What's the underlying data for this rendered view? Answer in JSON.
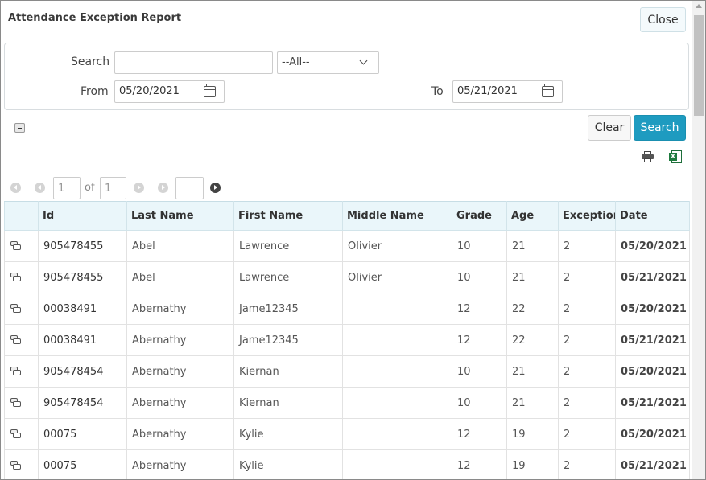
{
  "window": {
    "title": "Attendance Exception Report",
    "close_label": "Close"
  },
  "filters": {
    "search_label": "Search",
    "search_value": "",
    "select_value": "--All--",
    "from_label": "From",
    "from_value": "05/20/2021",
    "to_label": "To",
    "to_value": "05/21/2021"
  },
  "actions": {
    "clear_label": "Clear",
    "search_label": "Search"
  },
  "pager": {
    "current_page": "1",
    "of_label": "of",
    "total_pages": "1",
    "goto_value": ""
  },
  "table": {
    "headers": [
      "",
      "Id",
      "Last Name",
      "First Name",
      "Middle Name",
      "Grade",
      "Age",
      "Exception",
      "Date"
    ],
    "rows": [
      {
        "id": "905478455",
        "last": "Abel",
        "first": "Lawrence",
        "middle": "Olivier",
        "grade": "10",
        "age": "21",
        "exception": "2",
        "date": "05/20/2021"
      },
      {
        "id": "905478455",
        "last": "Abel",
        "first": "Lawrence",
        "middle": "Olivier",
        "grade": "10",
        "age": "21",
        "exception": "2",
        "date": "05/21/2021"
      },
      {
        "id": "00038491",
        "last": "Abernathy",
        "first": "Jame12345",
        "middle": "",
        "grade": "12",
        "age": "22",
        "exception": "2",
        "date": "05/20/2021"
      },
      {
        "id": "00038491",
        "last": "Abernathy",
        "first": "Jame12345",
        "middle": "",
        "grade": "12",
        "age": "22",
        "exception": "2",
        "date": "05/21/2021"
      },
      {
        "id": "905478454",
        "last": "Abernathy",
        "first": "Kiernan",
        "middle": "",
        "grade": "10",
        "age": "21",
        "exception": "2",
        "date": "05/20/2021"
      },
      {
        "id": "905478454",
        "last": "Abernathy",
        "first": "Kiernan",
        "middle": "",
        "grade": "10",
        "age": "21",
        "exception": "2",
        "date": "05/21/2021"
      },
      {
        "id": "00075",
        "last": "Abernathy",
        "first": "Kylie",
        "middle": "",
        "grade": "12",
        "age": "19",
        "exception": "2",
        "date": "05/20/2021"
      },
      {
        "id": "00075",
        "last": "Abernathy",
        "first": "Kylie",
        "middle": "",
        "grade": "12",
        "age": "19",
        "exception": "2",
        "date": "05/21/2021"
      }
    ]
  },
  "icons": {
    "row_action": "view-record-icon",
    "print": "print-icon",
    "export": "excel-export-icon",
    "calendar": "calendar-icon"
  },
  "colors": {
    "primary": "#1e9bc0",
    "header_bg": "#eaf6fa"
  }
}
